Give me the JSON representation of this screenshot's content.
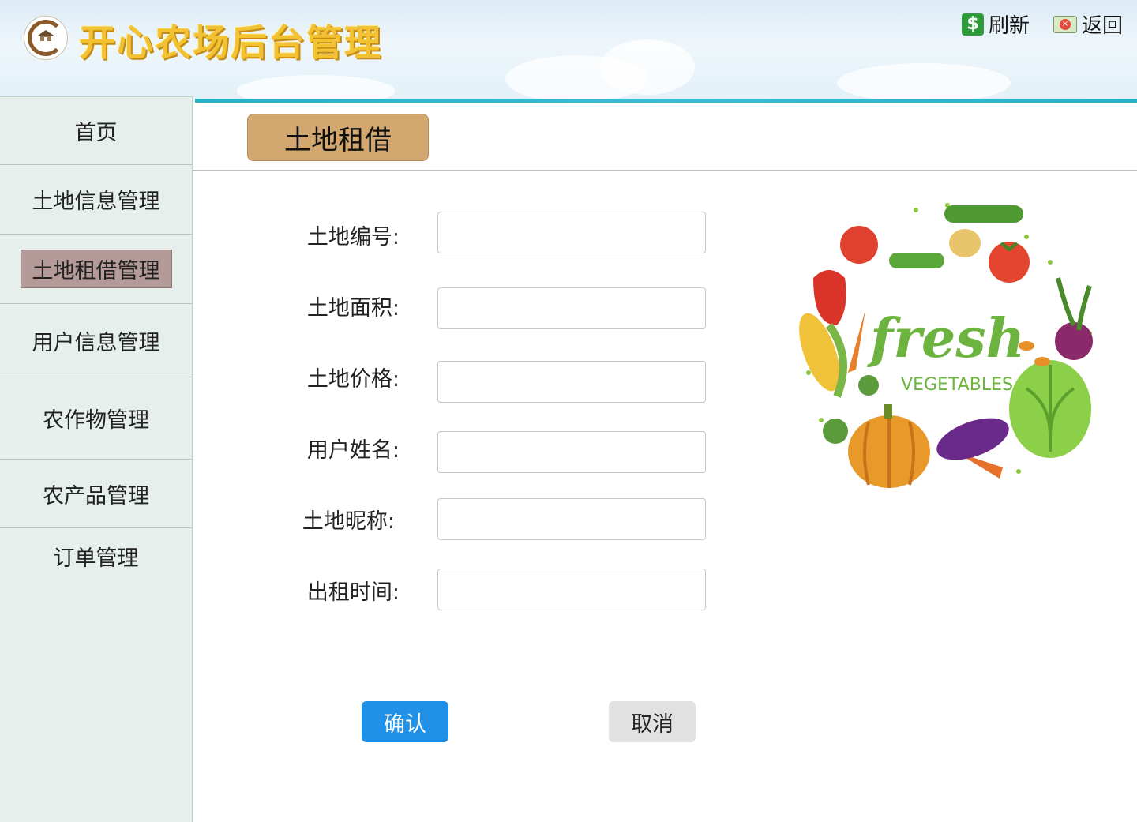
{
  "header": {
    "app_title": "开心农场后台管理",
    "refresh_label": "刷新",
    "back_label": "返回"
  },
  "sidebar": {
    "items": [
      {
        "label": "首页"
      },
      {
        "label": "土地信息管理"
      },
      {
        "label": "土地租借管理",
        "active": true
      },
      {
        "label": "用户信息管理"
      },
      {
        "label": "农作物管理"
      },
      {
        "label": "农产品管理"
      },
      {
        "label": "订单管理"
      }
    ]
  },
  "main": {
    "tab_title": "土地租借",
    "form": {
      "fields": [
        {
          "label": "土地编号:",
          "value": ""
        },
        {
          "label": "土地面积:",
          "value": ""
        },
        {
          "label": "土地价格:",
          "value": ""
        },
        {
          "label": "用户姓名:",
          "value": ""
        },
        {
          "label": "土地昵称:",
          "value": ""
        },
        {
          "label": "出租时间:",
          "value": ""
        }
      ],
      "confirm_label": "确认",
      "cancel_label": "取消"
    },
    "image": {
      "word1": "fresh",
      "word2": "VEGETABLES"
    }
  },
  "colors": {
    "accent_blue": "#2191e8",
    "tab_tan": "#d2a870",
    "sidebar_bg": "#e6efeb",
    "active_item": "#b59a9a",
    "title_gold": "#f2c232",
    "top_line": "#2ab0c3"
  },
  "icons": [
    "logo-icon",
    "refresh-icon",
    "back-icon"
  ]
}
